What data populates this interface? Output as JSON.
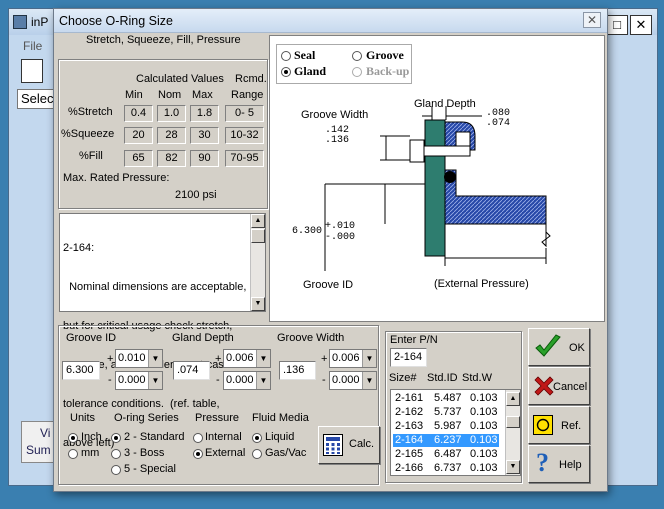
{
  "background_app": {
    "title": "inP",
    "menu_file": "File",
    "select_text": "Selec",
    "btn_vi": "Vi",
    "btn_sum": "Sum",
    "max_label": "□",
    "close_label": "✕"
  },
  "dialog": {
    "title": "Choose O-Ring Size",
    "close_label": "✕",
    "subtitle": "Stretch, Squeeze, Fill, Pressure",
    "calc_values": {
      "header": "Calculated Values",
      "rcmd": "Rcmd.",
      "cols": [
        "Min",
        "Nom",
        "Max",
        "Range"
      ],
      "rows": [
        {
          "label": "%Stretch",
          "min": "0.4",
          "nom": "1.0",
          "max": "1.8",
          "range": "0- 5"
        },
        {
          "label": "%Squeeze",
          "min": "20",
          "nom": "28",
          "max": "30",
          "range": "10-32"
        },
        {
          "label": "%Fill",
          "min": "65",
          "nom": "82",
          "max": "90",
          "range": "70-95"
        }
      ],
      "max_pressure_label": "Max. Rated Pressure:",
      "max_pressure_value": "2100 psi"
    },
    "message_lines": [
      "2-164:",
      "  Nominal dimensions are acceptable,",
      "but for critical usage check stretch,",
      "squeeze, and fill under worst-case",
      "tolerance conditions.  (ref. table,",
      "above left)"
    ],
    "diagram": {
      "opt_seal": "Seal",
      "opt_groove": "Groove",
      "opt_gland": "Gland",
      "opt_backup": "Back-up",
      "groove_width": "Groove Width",
      "gland_depth": "Gland Depth",
      "gw_upper": ".142",
      "gw_lower": ".136",
      "gd_upper": ".080",
      "gd_lower": ".074",
      "id_nom": "6.300",
      "id_plus": "+.010",
      "id_minus": "-.000",
      "groove_id": "Groove ID",
      "ext_pressure": "(External Pressure)"
    },
    "inputs": {
      "groove_id_label": "Groove ID",
      "groove_id_value": "6.300",
      "groove_id_plus": "0.010",
      "groove_id_minus": "0.000",
      "gland_depth_label": "Gland Depth",
      "gland_depth_value": ".074",
      "gland_depth_plus": "0.006",
      "gland_depth_minus": "0.000",
      "groove_width_label": "Groove Width",
      "groove_width_value": ".136",
      "groove_width_plus": "0.006",
      "groove_width_minus": "0.000",
      "plus_sign": "+",
      "minus_sign": "-"
    },
    "options": {
      "units_label": "Units",
      "units": [
        "Inch",
        "mm"
      ],
      "series_label": "O-ring Series",
      "series": [
        "2 - Standard",
        "3 - Boss",
        "5 - Special"
      ],
      "pressure_label": "Pressure",
      "pressure": [
        "Internal",
        "External"
      ],
      "fluid_label": "Fluid Media",
      "fluid": [
        "Liquid",
        "Gas/Vac"
      ],
      "calc_button": "Calc."
    },
    "pn": {
      "enter_label": "Enter P/N",
      "value": "2-164",
      "col_size": "Size#",
      "col_id": "Std.ID",
      "col_w": "Std.W",
      "rows": [
        {
          "size": "2-161",
          "id": "5.487",
          "w": "0.103"
        },
        {
          "size": "2-162",
          "id": "5.737",
          "w": "0.103"
        },
        {
          "size": "2-163",
          "id": "5.987",
          "w": "0.103"
        },
        {
          "size": "2-164",
          "id": "6.237",
          "w": "0.103"
        },
        {
          "size": "2-165",
          "id": "6.487",
          "w": "0.103"
        },
        {
          "size": "2-166",
          "id": "6.737",
          "w": "0.103"
        }
      ],
      "selected_index": 3
    },
    "buttons": {
      "ok": "OK",
      "cancel": "Cancel",
      "ref": "Ref.",
      "help": "Help"
    },
    "colors": {
      "gland_teal": "#2e7d6f",
      "groove_blue": "#2748a8",
      "select_blue": "#3399ff",
      "ok_green": "#2aa02a",
      "cancel_red": "#c01818",
      "ref_yellow": "#ffe000"
    }
  }
}
